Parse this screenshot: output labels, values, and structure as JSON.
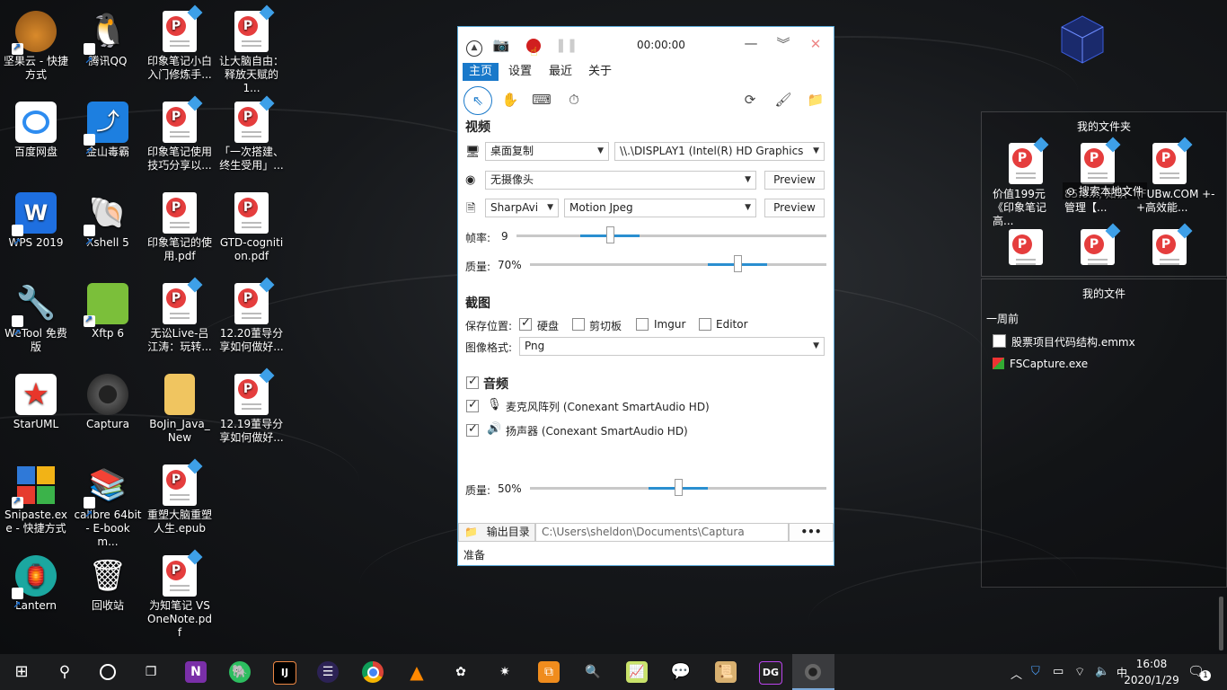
{
  "desktop": {
    "icons_col1": [
      "坚果云 - 快捷方式",
      "百度网盘",
      "WPS 2019",
      "WeTool 免费版",
      "StarUML",
      "Snipaste.exe - 快捷方式",
      "Lantern"
    ],
    "icons_col2": [
      "腾讯QQ",
      "金山毒霸",
      "Xshell 5",
      "Xftp 6",
      "Captura",
      "calibre 64bit - E-book m...",
      "回收站"
    ],
    "icons_col3": [
      "印象笔记小白入门修炼手...",
      "印象笔记使用技巧分享以...",
      "印象笔记的使用.pdf",
      "无讼Live-吕江涛：玩转...",
      "BoJin_Java_New",
      "重塑大脑重塑人生.epub",
      "为知笔记 VS OneNote.pdf"
    ],
    "icons_col4": [
      "让大脑自由：释放天赋的1...",
      "「一次搭建、终生受用」...",
      "GTD-cognition.pdf",
      "12.20董导分享如何做好...",
      "12.19董导分享如何做好..."
    ]
  },
  "captura": {
    "timer": "00:00:00",
    "menu": [
      "主页",
      "设置",
      "最近",
      "关于"
    ],
    "video": {
      "heading": "视频",
      "source": "桌面复制",
      "display": "\\\\.\\DISPLAY1 (Intel(R) HD Graphics",
      "webcam": "无摄像头",
      "preview1": "Preview",
      "writer": "SharpAvi",
      "codec": "Motion Jpeg",
      "preview2": "Preview",
      "fps_label": "帧率:",
      "fps_value": "9",
      "fps_level": 0.3,
      "quality_label": "质量:",
      "quality_value": "70%",
      "quality_level": 0.7
    },
    "screenshot": {
      "heading": "截图",
      "save_label": "保存位置:",
      "targets": [
        "硬盘",
        "剪切板",
        "Imgur",
        "Editor"
      ],
      "format_label": "图像格式:",
      "format": "Png"
    },
    "audio": {
      "heading": "音频",
      "mic": "麦克风阵列 (Conexant SmartAudio HD)",
      "speaker": "扬声器 (Conexant SmartAudio HD)",
      "quality_label": "质量:",
      "quality_value": "50%",
      "quality_level": 0.5
    },
    "output": {
      "label": "输出目录",
      "path": "C:\\Users\\sheldon\\Documents\\Captura",
      "more": "•••"
    },
    "status": "准备"
  },
  "folders_panel": {
    "title": "我的文件夹",
    "search": "搜索本地文件",
    "items": [
      "价值199元《印象笔记高...",
      "85.0..., 知识管理【...",
      "(FUBw.COM +-+高效能..."
    ]
  },
  "files_panel": {
    "title": "我的文件",
    "group": "一周前",
    "files": [
      "股票项目代码结构.emmx",
      "FSCapture.exe"
    ]
  },
  "taskbar": {
    "time": "16:08",
    "date": "2020/1/29",
    "notification_count": "1"
  }
}
